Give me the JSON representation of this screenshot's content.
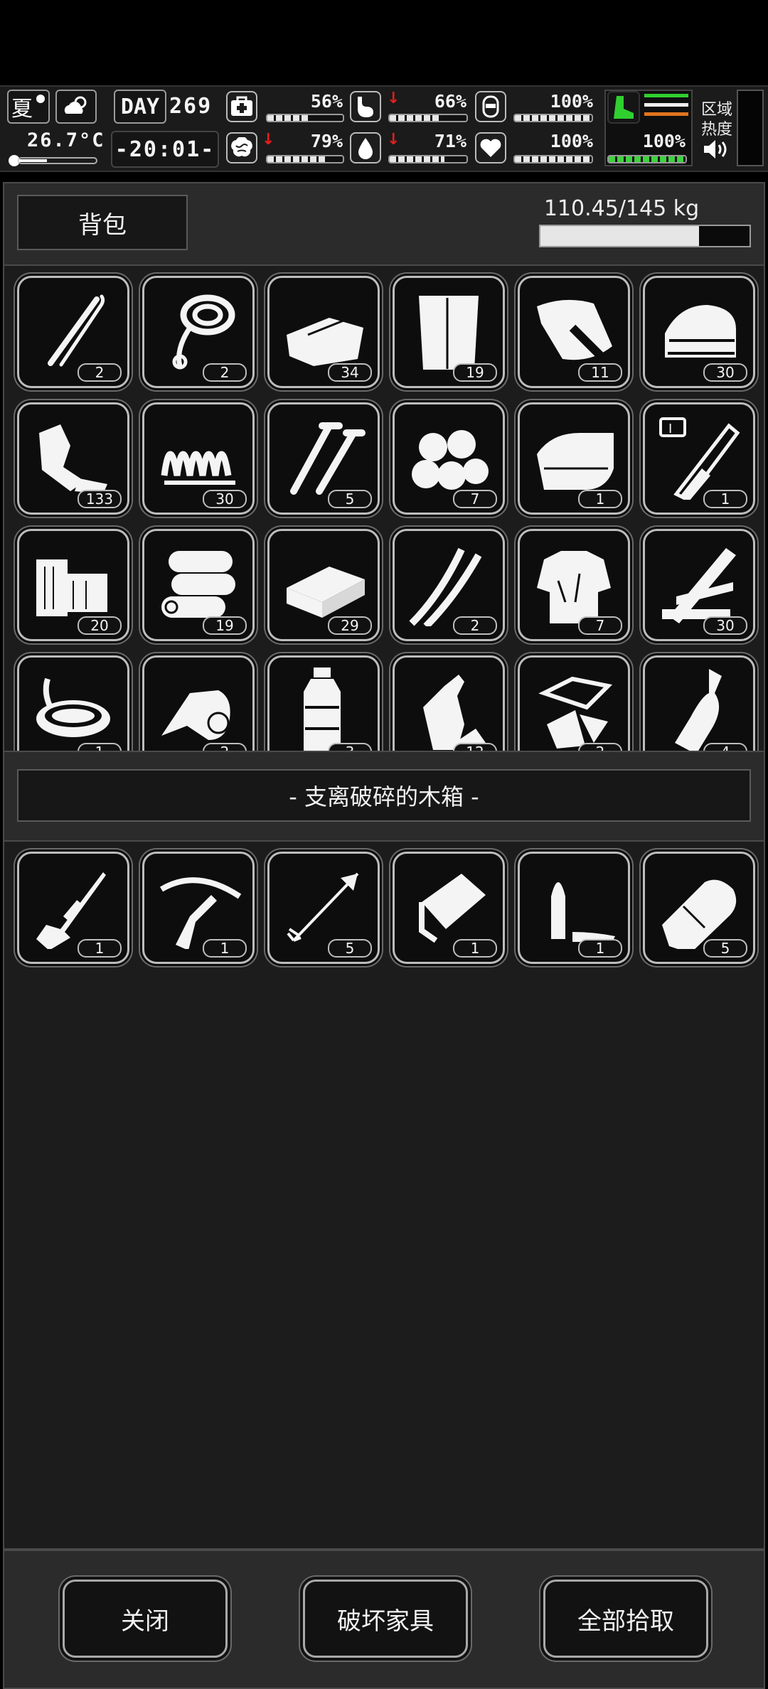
{
  "status": {
    "season": "夏",
    "temperature": "26.7°C",
    "day_label": "DAY",
    "day_number": "269",
    "clock": "-20:01-",
    "health_pct": "56%",
    "hunger_pct": "66%",
    "armor_pct": "100%",
    "sanity_pct": "79%",
    "thirst_pct": "71%",
    "heart_pct": "100%",
    "stamina_pct": "100%",
    "zone_label_1": "区域",
    "zone_label_2": "热度",
    "levels": {
      "health": 0.56,
      "hunger": 0.66,
      "armor": 1.0,
      "sanity": 0.79,
      "thirst": 0.71,
      "heart": 1.0,
      "stamina": 1.0
    },
    "colors": {
      "warning_arrow": "#e41e1e",
      "stamina_green": "#3fd23f",
      "boot_green": "#2fcf2f"
    }
  },
  "backpack": {
    "title": "背包",
    "weight": "110.45/145 kg",
    "weight_fill": 0.76,
    "items": [
      {
        "icon": "lockpick-icon",
        "count": "2"
      },
      {
        "icon": "rope-icon",
        "count": "2"
      },
      {
        "icon": "cloth-sheets-icon",
        "count": "34"
      },
      {
        "icon": "paper-sack-icon",
        "count": "19"
      },
      {
        "icon": "food-bag-icon",
        "count": "11"
      },
      {
        "icon": "folded-rags-icon",
        "count": "30"
      },
      {
        "icon": "scrap-metal-icon",
        "count": "133"
      },
      {
        "icon": "spring-icon",
        "count": "30"
      },
      {
        "icon": "screws-icon",
        "count": "5"
      },
      {
        "icon": "cotton-balls-icon",
        "count": "7"
      },
      {
        "icon": "fabric-roll-icon",
        "count": "1"
      },
      {
        "icon": "test-tube-icon",
        "count": "1"
      },
      {
        "icon": "wood-blocks-icon",
        "count": "20"
      },
      {
        "icon": "logs-icon",
        "count": "19"
      },
      {
        "icon": "plank-box-icon",
        "count": "29"
      },
      {
        "icon": "wires-icon",
        "count": "2"
      },
      {
        "icon": "torn-shirt-icon",
        "count": "7"
      },
      {
        "icon": "planks-icon",
        "count": "30"
      },
      {
        "icon": "soup-bowl-icon",
        "count": "1"
      },
      {
        "icon": "bandage-icon",
        "count": "2"
      },
      {
        "icon": "water-bottle-icon",
        "count": "3"
      },
      {
        "icon": "crushed-bottle-icon",
        "count": "12"
      },
      {
        "icon": "glass-shards-icon",
        "count": "2"
      },
      {
        "icon": "glass-bottle-icon",
        "count": "4"
      }
    ]
  },
  "container": {
    "title": "- 支离破碎的木箱 -",
    "items": [
      {
        "icon": "sniper-rifle-icon",
        "count": "1"
      },
      {
        "icon": "crossbow-icon",
        "count": "1"
      },
      {
        "icon": "arrow-icon",
        "count": "5"
      },
      {
        "icon": "ammo-box-icon",
        "count": "1"
      },
      {
        "icon": "bullet-knife-icon",
        "count": "1"
      },
      {
        "icon": "cartridge-icon",
        "count": "5"
      }
    ]
  },
  "buttons": {
    "close": "关闭",
    "destroy": "破坏家具",
    "take_all": "全部拾取"
  }
}
